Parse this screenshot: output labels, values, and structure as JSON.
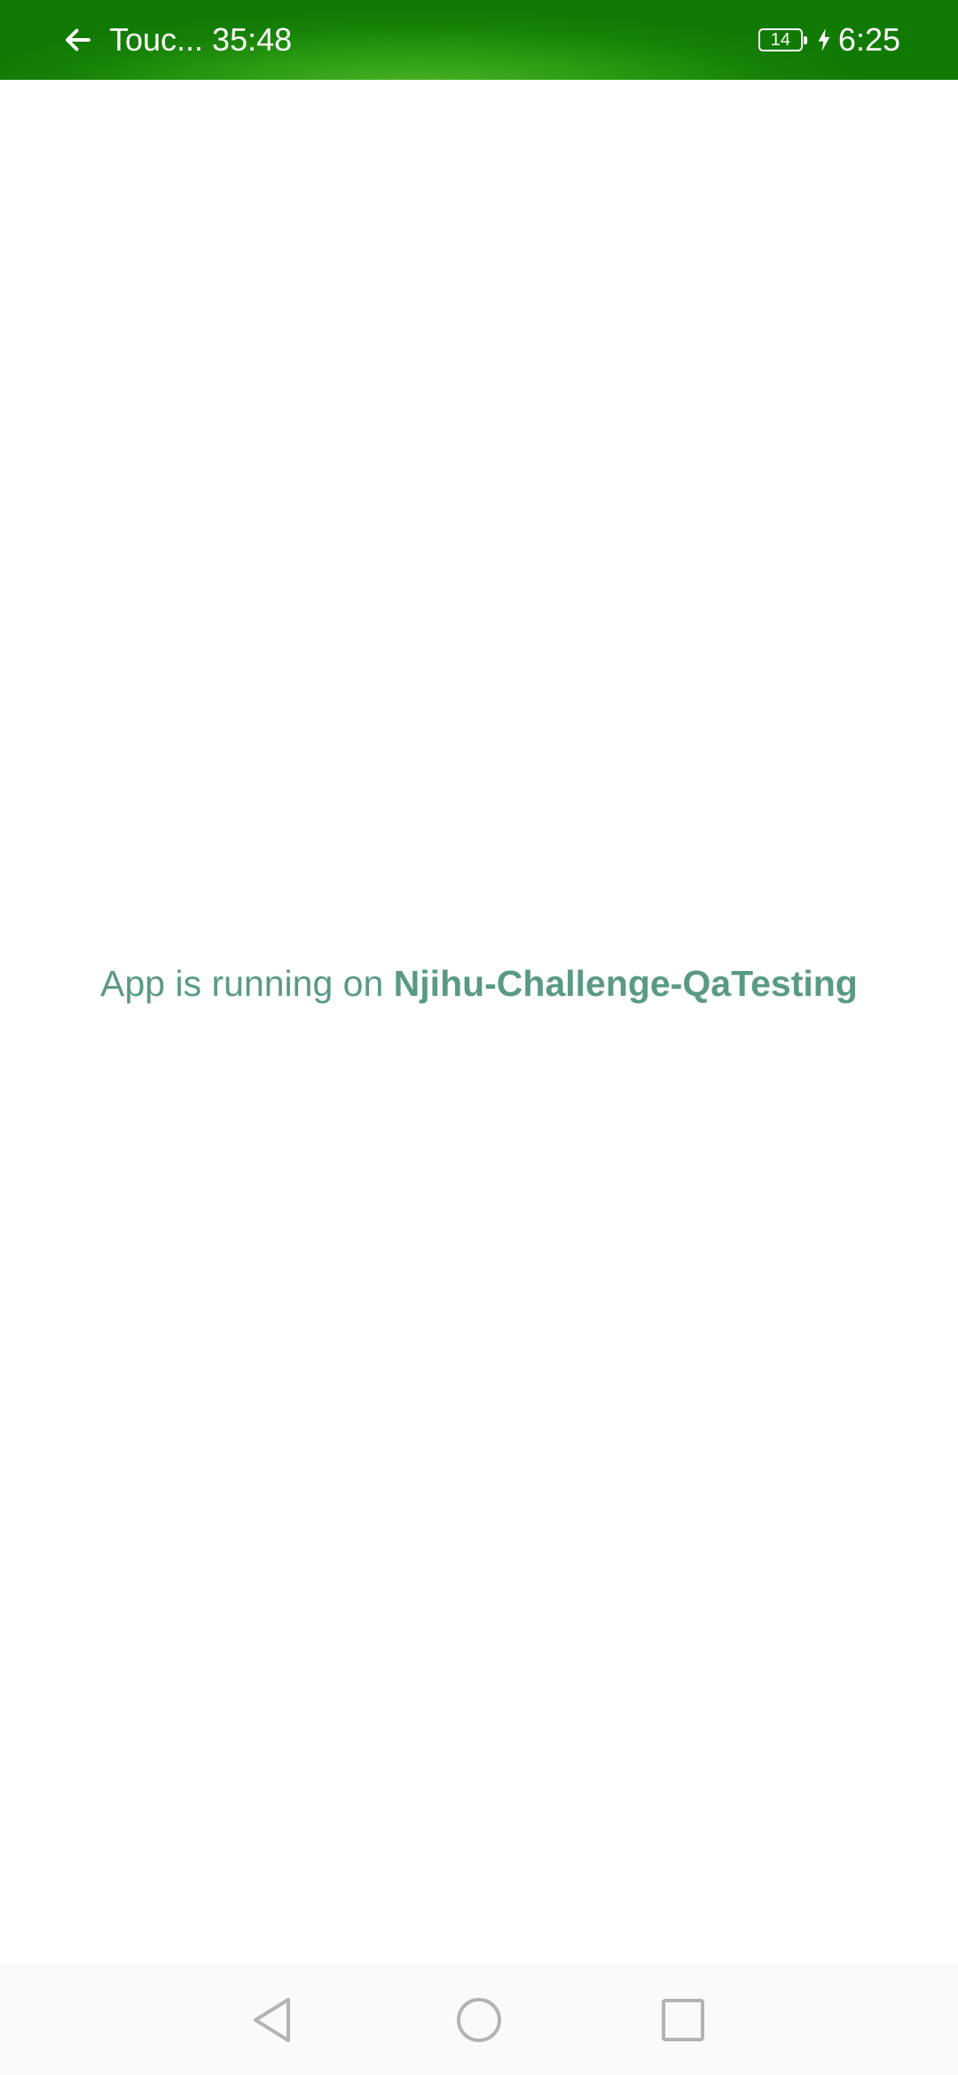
{
  "status_bar": {
    "back_icon": "arrow-left-icon",
    "title": "Touc... 35:48",
    "battery_level": "14",
    "charging_icon": "lightning-bolt-icon",
    "time": "6:25",
    "background_color": "#1a8a0a"
  },
  "main": {
    "message_prefix": "App is running on ",
    "project_name": "Njihu-Challenge-QaTesting",
    "text_color": "#5a9a82"
  },
  "nav_bar": {
    "back_icon": "triangle-back-icon",
    "home_icon": "circle-home-icon",
    "recents_icon": "square-recents-icon"
  }
}
